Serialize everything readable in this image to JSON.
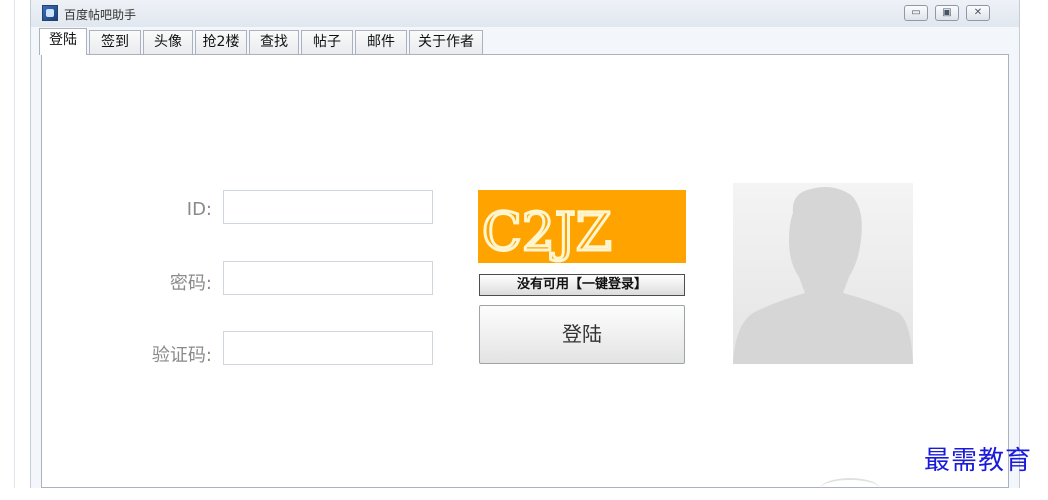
{
  "window": {
    "title": "百度帖吧助手",
    "minimize_icon": "minimize-icon",
    "maximize_icon": "maximize-icon",
    "close_icon": "close-icon"
  },
  "tabs": [
    {
      "label": "登陆",
      "active": true
    },
    {
      "label": "签到"
    },
    {
      "label": "头像"
    },
    {
      "label": "抢2楼"
    },
    {
      "label": "查找"
    },
    {
      "label": "帖子"
    },
    {
      "label": "邮件"
    },
    {
      "label": "关于作者"
    }
  ],
  "login_form": {
    "id_label": "ID:",
    "password_label": "密码:",
    "captcha_label": "验证码:",
    "id_value": "",
    "password_value": "",
    "captcha_value": ""
  },
  "captcha": {
    "text": "C2JZ",
    "background": "#ffa300"
  },
  "buttons": {
    "no_available_label": "没有可用【一键登录】",
    "login_label": "登陆"
  },
  "avatar": {
    "icon": "default-avatar-icon"
  },
  "watermark": "最需教育"
}
